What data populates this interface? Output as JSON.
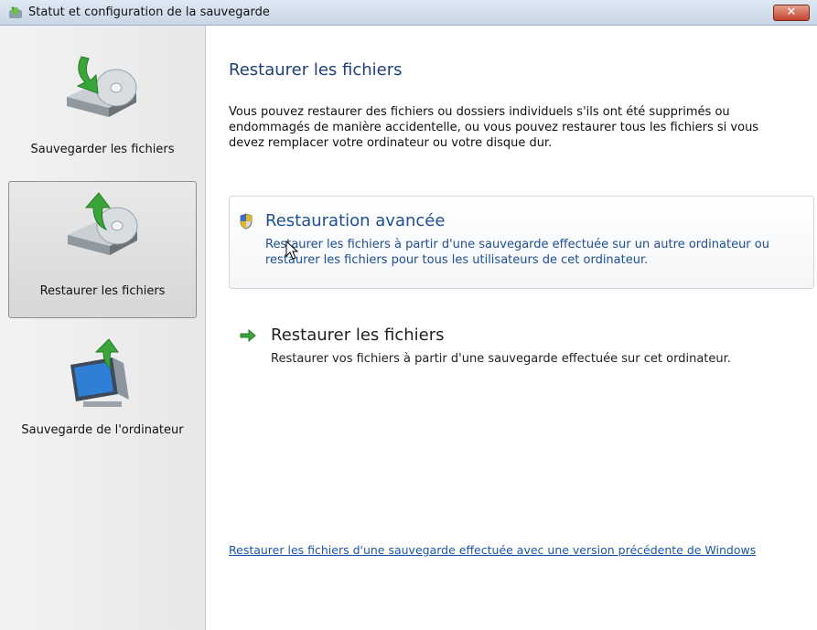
{
  "window": {
    "title": "Statut et configuration de la sauvegarde",
    "close_label": "✕"
  },
  "sidebar": {
    "items": [
      {
        "label": "Sauvegarder les fichiers",
        "icon": "drive-backup-icon",
        "active": false
      },
      {
        "label": "Restaurer les fichiers",
        "icon": "drive-restore-icon",
        "active": true
      },
      {
        "label": "Sauvegarde de l'ordinateur",
        "icon": "computer-backup-icon",
        "active": false
      }
    ]
  },
  "main": {
    "heading": "Restaurer les fichiers",
    "description": "Vous pouvez restaurer des fichiers ou dossiers individuels s'ils ont été supprimés ou endommagés de manière accidentelle, ou vous pouvez restaurer tous les fichiers si vous devez remplacer votre ordinateur ou votre disque dur.",
    "options": [
      {
        "title": "Restauration avancée",
        "description": "Restaurer les fichiers à partir d'une sauvegarde effectuée sur un autre ordinateur ou restaurer les fichiers pour tous les utilisateurs de cet ordinateur.",
        "icon": "shield-icon"
      },
      {
        "title": "Restaurer les fichiers",
        "description": "Restaurer vos fichiers à partir d'une sauvegarde effectuée sur cet ordinateur.",
        "icon": "green-arrow-icon"
      }
    ],
    "bottom_link": "Restaurer les fichiers d'une sauvegarde effectuée avec une version précédente de Windows"
  },
  "colors": {
    "heading": "#1e3f78",
    "link": "#1a55a8",
    "accent_green": "#3aa63a"
  }
}
